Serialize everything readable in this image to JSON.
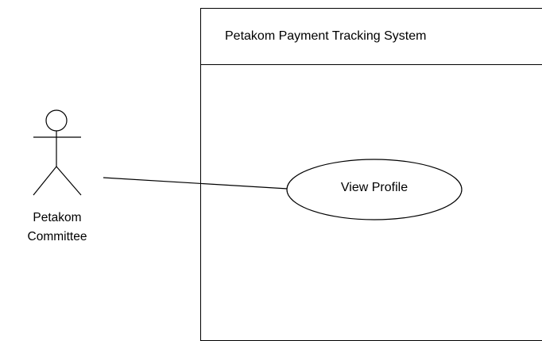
{
  "system": {
    "title": "Petakom Payment Tracking System"
  },
  "actor": {
    "label_line1": "Petakom",
    "label_line2": "Committee"
  },
  "use_case": {
    "label": "View Profile"
  },
  "colors": {
    "stroke": "#000000",
    "background": "#ffffff"
  }
}
